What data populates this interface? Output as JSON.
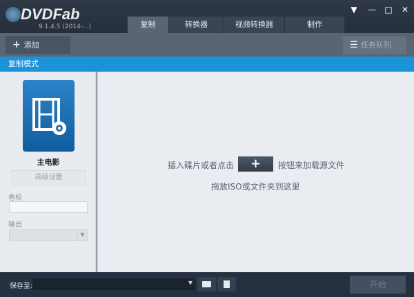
{
  "app": {
    "logo": "DVDFab",
    "version": "9.1.4.5 (2014-...)"
  },
  "window_controls": {
    "menu": "▼",
    "minimize": "—",
    "maximize": "□",
    "close": "✕"
  },
  "tabs": [
    {
      "label": "复制"
    },
    {
      "label": "转换器"
    },
    {
      "label": "视频转换器"
    },
    {
      "label": "制作"
    }
  ],
  "toolbar": {
    "add_label": "添加",
    "queue_label": "任务队列"
  },
  "mode_bar": {
    "title": "复制模式"
  },
  "sidebar": {
    "mode_name": "主电影",
    "advanced_button": "高级设置",
    "volume_label": "卷标",
    "volume_value": "",
    "output_label": "输出",
    "output_value": ""
  },
  "main": {
    "hint_before": "插入碟片或者点击",
    "plus": "+",
    "hint_after": "按钮来加载源文件",
    "hint_drag": "拖放ISO或文件夹到这里"
  },
  "bottom": {
    "save_label": "保存至:",
    "save_value": "",
    "start_label": "开始"
  },
  "colors": {
    "accent": "#1a93d8",
    "titlebar": "#2b3442",
    "toolbar": "#5a6573"
  }
}
